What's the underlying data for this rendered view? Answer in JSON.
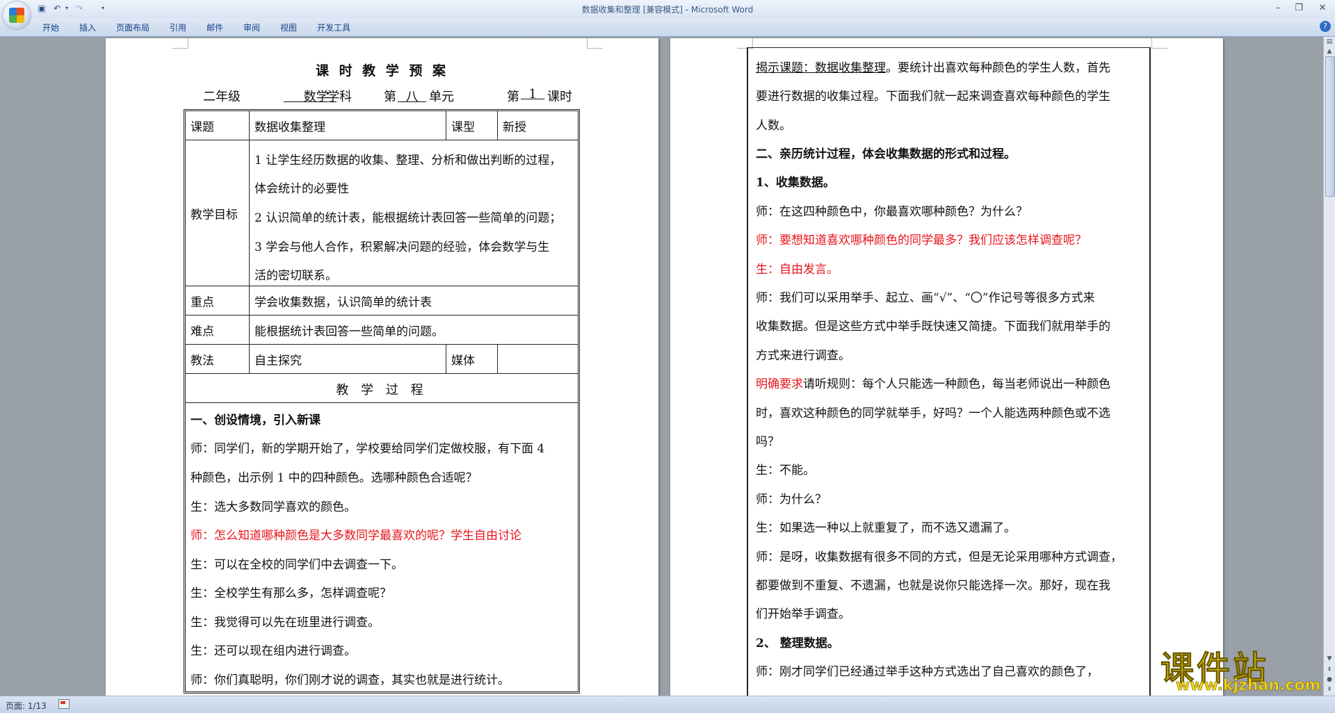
{
  "window": {
    "title": "数据收集和整理 [兼容模式] - Microsoft Word"
  },
  "ribbon": {
    "tabs": [
      "开始",
      "插入",
      "页面布局",
      "引用",
      "邮件",
      "审阅",
      "视图",
      "开发工具"
    ]
  },
  "left_page": {
    "title": "课 时 教 学 预 案",
    "meta": {
      "grade": "二年级",
      "subject": "数学",
      "subject_suffix": "学科",
      "unit_prefix": "第",
      "unit": "八",
      "unit_suffix": "单元",
      "period_prefix": "第",
      "period": "1",
      "period_suffix": "课时"
    },
    "table": {
      "topic_label": "课题",
      "topic_value": "数据收集整理",
      "type_label": "课型",
      "type_value": "新授",
      "goals_label": "教学目标",
      "goals_lines": [
        "1 让学生经历数据的收集、整理、分析和做出判断的过程，",
        "体会统计的必要性",
        "2 认识简单的统计表，能根据统计表回答一些简单的问题；",
        "3 学会与他人合作，积累解决问题的经验，体会数学与生",
        "活的密切联系。"
      ],
      "key_label": "重点",
      "key_value": "学会收集数据，认识简单的统计表",
      "difficulty_label": "难点",
      "difficulty_value": "能根据统计表回答一些简单的问题。",
      "method_label": "教法",
      "method_value": "自主探究",
      "media_label": "媒体",
      "media_value": "",
      "process_heading": "教 学 过 程"
    },
    "process_lines": [
      {
        "text": "一、创设情境，引入新课",
        "style": "bold"
      },
      {
        "text": "师：同学们，新的学期开始了，学校要给同学们定做校服，有下面 4",
        "style": "normal"
      },
      {
        "text": "种颜色，出示例 1 中的四种颜色。选哪种颜色合适呢？",
        "style": "normal"
      },
      {
        "text": " 生：选大多数同学喜欢的颜色。",
        "style": "normal"
      },
      {
        "text": " 师：怎么知道哪种颜色是大多数同学最喜欢的呢？学生自由讨论",
        "style": "red"
      },
      {
        "text": "生：可以在全校的同学们中去调查一下。",
        "style": "normal"
      },
      {
        "text": "生：全校学生有那么多，怎样调查呢？",
        "style": "normal"
      },
      {
        "text": "生：我觉得可以先在班里进行调查。",
        "style": "normal"
      },
      {
        "text": "生：还可以现在组内进行调查。",
        "style": "normal"
      },
      {
        "text": "师：你们真聪明，你们刚才说的调查，其实也就是进行统计。",
        "style": "normal"
      }
    ]
  },
  "right_page": {
    "intro_underlined": "揭示课题：数据收集整理",
    "lines": [
      {
        "text": "。要统计出喜欢每种颜色的学生人数，首先",
        "style": "normal"
      },
      {
        "text": "要进行数据的收集过程。下面我们就一起来调查喜欢每种颜色的学生",
        "style": "normal"
      },
      {
        "text": "人数。",
        "style": "normal"
      },
      {
        "text": "二、亲历统计过程，体会收集数据的形式和过程。",
        "style": "bold"
      },
      {
        "text": "1、收集数据。",
        "style": "bold"
      },
      {
        "text": "师：在这四种颜色中，你最喜欢哪种颜色？为什么？",
        "style": "normal"
      },
      {
        "text": "师：要想知道喜欢哪种颜色的同学最多？我们应该怎样调查呢？",
        "style": "red"
      },
      {
        "text": "生：自由发言。",
        "style": "red"
      },
      {
        "text": "师：我们可以采用举手、起立、画“√”、“〇”作记号等很多方式来",
        "style": "normal"
      },
      {
        "text": "收集数据。但是这些方式中举手既快速又简捷。下面我们就用举手的",
        "style": "normal"
      },
      {
        "text": "方式来进行调查。",
        "style": "normal"
      },
      {
        "text": "请听规则：每个人只能选一种颜色，每当老师说出一种颜色",
        "style": "normal",
        "prefix": "明确要求",
        "prefix_style": "red"
      },
      {
        "text": "时，喜欢这种颜色的同学就举手，好吗？一个人能选两种颜色或不选",
        "style": "normal"
      },
      {
        "text": "吗？",
        "style": "normal"
      },
      {
        "text": " 生：不能。",
        "style": "normal"
      },
      {
        "text": "师：为什么？",
        "style": "normal"
      },
      {
        "text": "生：如果选一种以上就重复了，而不选又遗漏了。",
        "style": "normal"
      },
      {
        "text": "师：是呀，收集数据有很多不同的方式，但是无论采用哪种方式调查，",
        "style": "normal"
      },
      {
        "text": "都要做到不重复、不遗漏，也就是说你只能选择一次。那好，现在我",
        "style": "normal"
      },
      {
        "text": "们开始举手调查。",
        "style": "normal"
      },
      {
        "text": " 2、 整理数据。",
        "style": "bold"
      },
      {
        "text": " 师：刚才同学们已经通过举手这种方式选出了自己喜欢的颜色了，",
        "style": "normal"
      }
    ]
  },
  "status_bar": {
    "page_indicator": "页面: 1/13"
  },
  "watermark": {
    "main": "课件站",
    "url": "www.kjzhan.com"
  }
}
